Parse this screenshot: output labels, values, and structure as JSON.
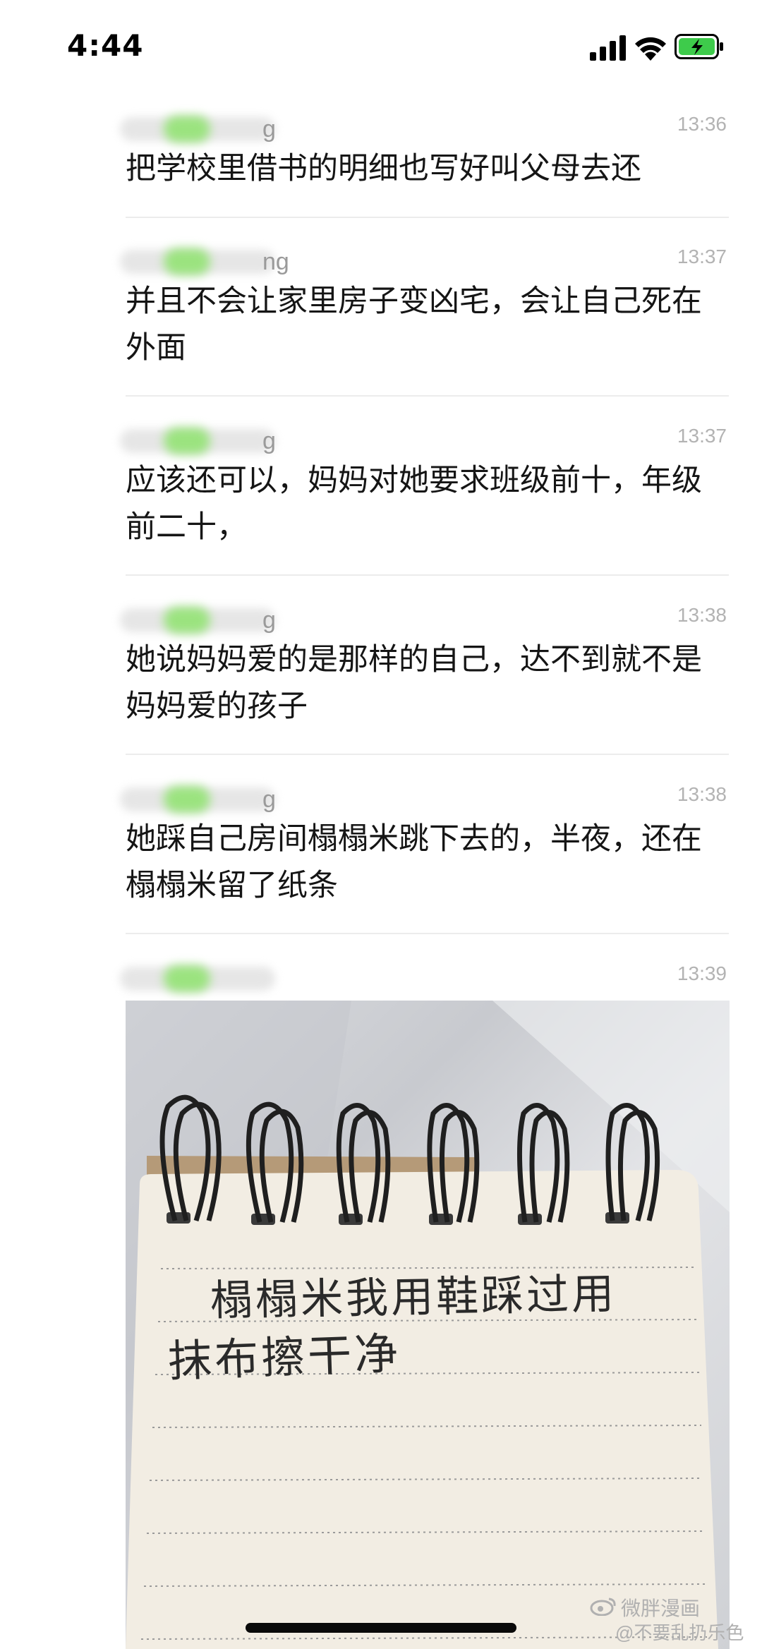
{
  "status_bar": {
    "time": "4:44"
  },
  "messages": [
    {
      "sender_fragment": "g",
      "time": "13:36",
      "text": "把学校里借书的明细也写好叫父母去还"
    },
    {
      "sender_fragment": "ng",
      "time": "13:37",
      "text": "并且不会让家里房子变凶宅，会让自己死在外面"
    },
    {
      "sender_fragment": "g",
      "time": "13:37",
      "text": "应该还可以，妈妈对她要求班级前十，年级前二十，"
    },
    {
      "sender_fragment": "g",
      "time": "13:38",
      "text": "她说妈妈爱的是那样的自己，达不到就不是妈妈爱的孩子"
    },
    {
      "sender_fragment": "g",
      "time": "13:38",
      "text": "她踩自己房间榻榻米跳下去的，半夜，还在榻榻米留了纸条"
    },
    {
      "sender_fragment": "",
      "time": "13:39",
      "text": ""
    }
  ],
  "photo": {
    "note_line1": "榻榻米我用鞋踩过用",
    "note_line2": "抹布擦干净"
  },
  "watermark": {
    "line1": "微胖漫画",
    "line2": "@不要乱扔乐色"
  },
  "colors": {
    "background": "#ffffff",
    "text": "#151515",
    "time": "#b3b3b3",
    "battery": "#3ecb4b"
  }
}
